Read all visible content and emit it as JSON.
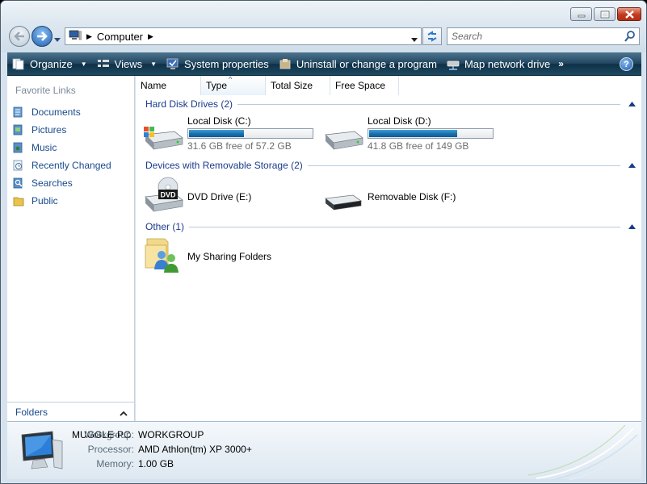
{
  "window": {
    "controls": {
      "minimize": "minimize-icon",
      "maximize": "maximize-icon",
      "close": "close-icon"
    }
  },
  "address": {
    "crumbs": [
      "Computer"
    ]
  },
  "search": {
    "placeholder": "Search"
  },
  "toolbar": {
    "items": [
      {
        "label": "Organize",
        "icon": "organize-icon",
        "has_dropdown": true
      },
      {
        "label": "Views",
        "icon": "views-icon",
        "has_dropdown": true
      },
      {
        "label": "System properties",
        "icon": "system-properties-icon"
      },
      {
        "label": "Uninstall or change a program",
        "icon": "uninstall-program-icon"
      },
      {
        "label": "Map network drive",
        "icon": "map-network-drive-icon"
      }
    ],
    "more": "»",
    "help": "?"
  },
  "nav": {
    "title": "Favorite Links",
    "links": [
      {
        "label": "Documents",
        "icon": "documents-icon"
      },
      {
        "label": "Pictures",
        "icon": "pictures-icon"
      },
      {
        "label": "Music",
        "icon": "music-icon"
      },
      {
        "label": "Recently Changed",
        "icon": "recently-changed-icon"
      },
      {
        "label": "Searches",
        "icon": "searches-icon"
      },
      {
        "label": "Public",
        "icon": "public-folder-icon"
      }
    ],
    "folders_label": "Folders"
  },
  "columns": [
    "Name",
    "Type",
    "Total Size",
    "Free Space"
  ],
  "groups": {
    "hdd": {
      "title": "Hard Disk Drives (2)",
      "items": [
        {
          "name": "Local Disk (C:)",
          "free_text": "31.6 GB free of 57.2 GB",
          "used_fraction": 0.45
        },
        {
          "name": "Local Disk (D:)",
          "free_text": "41.8 GB free of 149 GB",
          "used_fraction": 0.72
        }
      ]
    },
    "removable": {
      "title": "Devices with Removable Storage (2)",
      "items": [
        {
          "name": "DVD Drive (E:)",
          "icon_text": "DVD"
        },
        {
          "name": "Removable Disk (F:)"
        }
      ]
    },
    "other": {
      "title": "Other (1)",
      "items": [
        {
          "name": "My Sharing Folders"
        }
      ]
    }
  },
  "details": {
    "computer_name": "MUGGLE-PC",
    "rows": [
      {
        "label": "Workgroup:",
        "value": "WORKGROUP"
      },
      {
        "label": "Processor:",
        "value": "AMD Athlon(tm) XP 3000+"
      },
      {
        "label": "Memory:",
        "value": "1.00 GB"
      }
    ]
  },
  "colors": {
    "link": "#1a4a8c",
    "group_heading": "#1a3a8c",
    "toolbar": "#1d4a61"
  }
}
